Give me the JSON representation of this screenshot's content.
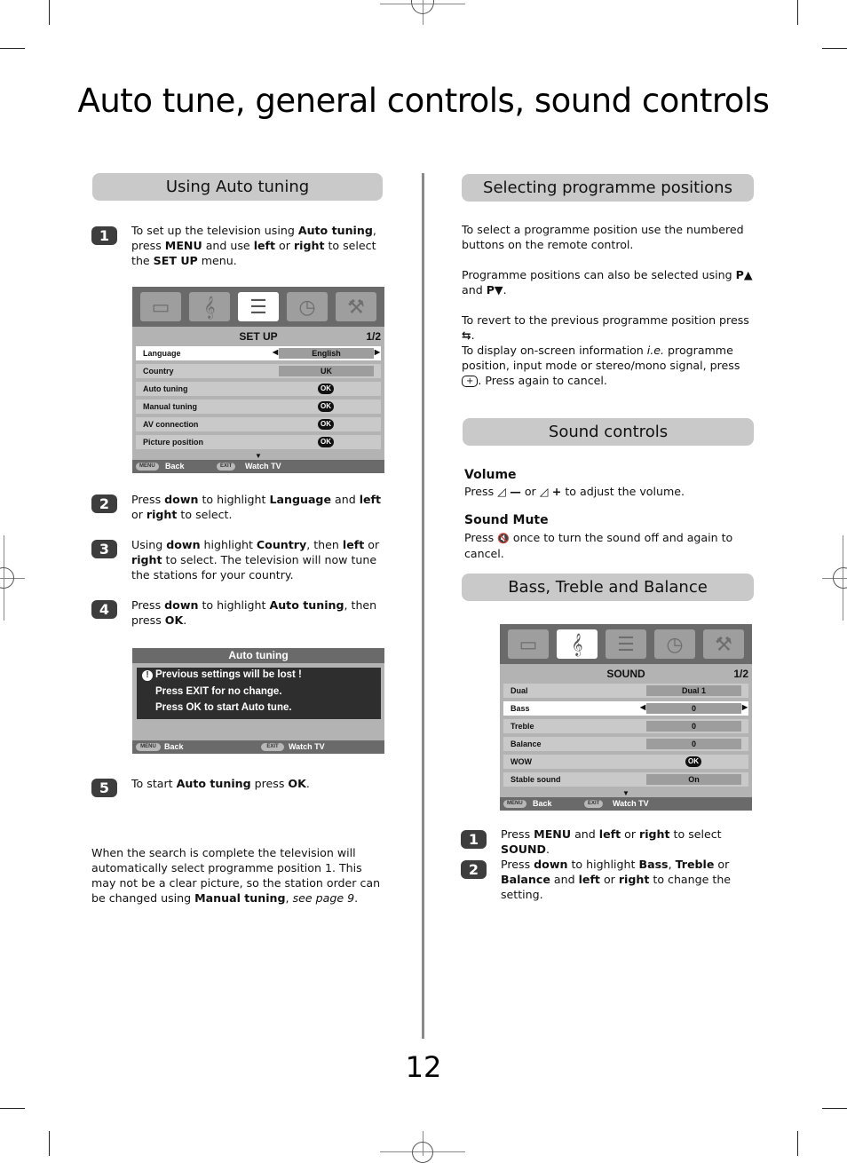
{
  "page": {
    "title": "Auto tune, general controls, sound controls",
    "page_number": "12"
  },
  "left": {
    "section_title": "Using Auto tuning",
    "steps": [
      {
        "num": "1",
        "parts": [
          [
            "To set up the television using ",
            false
          ],
          [
            "Auto tuning",
            true
          ],
          [
            ", press ",
            false
          ],
          [
            "MENU",
            true
          ],
          [
            " and use ",
            false
          ],
          [
            "left",
            true
          ],
          [
            " or ",
            false
          ],
          [
            "right",
            true
          ],
          [
            " to select the ",
            false
          ],
          [
            "SET UP",
            true
          ],
          [
            " menu.",
            false
          ]
        ]
      },
      {
        "num": "2",
        "parts": [
          [
            "Press ",
            false
          ],
          [
            "down",
            true
          ],
          [
            " to highlight ",
            false
          ],
          [
            "Language",
            true
          ],
          [
            " and ",
            false
          ],
          [
            "left",
            true
          ],
          [
            " or ",
            false
          ],
          [
            "right",
            true
          ],
          [
            " to select.",
            false
          ]
        ]
      },
      {
        "num": "3",
        "parts": [
          [
            "Using ",
            false
          ],
          [
            "down",
            true
          ],
          [
            " highlight ",
            false
          ],
          [
            "Country",
            true
          ],
          [
            ", then ",
            false
          ],
          [
            "left",
            true
          ],
          [
            " or ",
            false
          ],
          [
            "right",
            true
          ],
          [
            " to select. The television will now tune the stations for your country.",
            false
          ]
        ]
      },
      {
        "num": "4",
        "parts": [
          [
            "Press ",
            false
          ],
          [
            "down",
            true
          ],
          [
            " to highlight ",
            false
          ],
          [
            "Auto tuning",
            true
          ],
          [
            ", then press ",
            false
          ],
          [
            "OK",
            true
          ],
          [
            ".",
            false
          ]
        ]
      },
      {
        "num": "5",
        "parts": [
          [
            "To start ",
            false
          ],
          [
            "Auto tuning",
            true
          ],
          [
            " press ",
            false
          ],
          [
            "OK",
            true
          ],
          [
            ".",
            false
          ]
        ]
      }
    ],
    "closing": [
      [
        "When the search is complete the television will automatically select programme position 1. This may not be a clear picture, so the station order can be changed using ",
        false
      ],
      [
        "Manual tuning",
        true
      ],
      [
        ", ",
        false
      ],
      [
        "see page 9",
        "i"
      ],
      [
        ".",
        false
      ]
    ],
    "setup_menu": {
      "icons": [
        "picture-icon",
        "sound-icon",
        "setup-icon",
        "timer-icon",
        "feature-icon"
      ],
      "selected_icon": 2,
      "header": "SET UP",
      "page": "1/2",
      "rows": [
        {
          "label": "Language",
          "value": "English",
          "type": "select",
          "highlighted": true
        },
        {
          "label": "Country",
          "value": "UK",
          "type": "value"
        },
        {
          "label": "Auto tuning",
          "value": "OK",
          "type": "ok"
        },
        {
          "label": "Manual tuning",
          "value": "OK",
          "type": "ok"
        },
        {
          "label": "AV connection",
          "value": "OK",
          "type": "ok"
        },
        {
          "label": "Picture position",
          "value": "OK",
          "type": "ok"
        }
      ],
      "footer": {
        "menu_key": "MENU",
        "menu_label": "Back",
        "exit_key": "EXIT",
        "exit_label": "Watch TV"
      }
    },
    "autotune_dialog": {
      "title": "Auto tuning",
      "lines": [
        "Previous settings will be lost  !",
        "Press EXIT for no change.",
        "Press OK to start Auto tune."
      ],
      "footer": {
        "menu_key": "MENU",
        "menu_label": "Back",
        "exit_key": "EXIT",
        "exit_label": "Watch TV"
      }
    }
  },
  "right": {
    "programme": {
      "section_title": "Selecting programme positions",
      "p1": "To select a programme position use the numbered buttons on the remote control.",
      "p2_a": "Programme positions can also be selected using ",
      "p2_b": "P▲",
      "p2_c": " and ",
      "p2_d": "P▼",
      "p2_e": ".",
      "p3_a": "To revert to the previous programme position press ",
      "p3_icon": "⇆",
      "p3_b": ".",
      "p4_a": "To display on-screen information ",
      "p4_i": "i.e.",
      "p4_b": " programme position, input mode or stereo/mono signal, press ",
      "p4_key": "+",
      "p4_c": ". Press again to cancel."
    },
    "sound": {
      "section_title": "Sound controls",
      "volume_title": "Volume",
      "volume_a": "Press ",
      "volume_minus": "◿ —",
      "volume_or": " or ",
      "volume_plus": "◿ +",
      "volume_b": " to adjust the volume.",
      "mute_title": "Sound Mute",
      "mute_a": "Press ",
      "mute_icon": "🔇",
      "mute_b": " once to turn the sound off and again to cancel."
    },
    "bass": {
      "section_title": "Bass, Treble and Balance",
      "sound_menu": {
        "icons": [
          "picture-icon",
          "sound-icon",
          "setup-icon",
          "timer-icon",
          "feature-icon"
        ],
        "selected_icon": 1,
        "header": "SOUND",
        "page": "1/2",
        "rows": [
          {
            "label": "Dual",
            "value": "Dual 1",
            "type": "value"
          },
          {
            "label": "Bass",
            "value": "0",
            "type": "select",
            "highlighted": true
          },
          {
            "label": "Treble",
            "value": "0",
            "type": "value"
          },
          {
            "label": "Balance",
            "value": "0",
            "type": "value"
          },
          {
            "label": "WOW",
            "value": "OK",
            "type": "ok"
          },
          {
            "label": "Stable sound",
            "value": "On",
            "type": "value"
          }
        ],
        "footer": {
          "menu_key": "MENU",
          "menu_label": "Back",
          "exit_key": "EXIT",
          "exit_label": "Watch TV"
        }
      },
      "steps": [
        {
          "num": "1",
          "parts": [
            [
              "Press ",
              false
            ],
            [
              "MENU",
              true
            ],
            [
              " and ",
              false
            ],
            [
              "left",
              true
            ],
            [
              " or ",
              false
            ],
            [
              "right",
              true
            ],
            [
              " to select ",
              false
            ],
            [
              "SOUND",
              true
            ],
            [
              ".",
              false
            ]
          ]
        },
        {
          "num": "2",
          "parts": [
            [
              "Press ",
              false
            ],
            [
              "down",
              true
            ],
            [
              " to highlight ",
              false
            ],
            [
              "Bass",
              true
            ],
            [
              ", ",
              false
            ],
            [
              "Treble",
              true
            ],
            [
              " or ",
              false
            ],
            [
              "Balance",
              true
            ],
            [
              " and ",
              false
            ],
            [
              "left",
              true
            ],
            [
              " or ",
              false
            ],
            [
              "right",
              true
            ],
            [
              " to change the setting.",
              false
            ]
          ]
        }
      ]
    }
  }
}
